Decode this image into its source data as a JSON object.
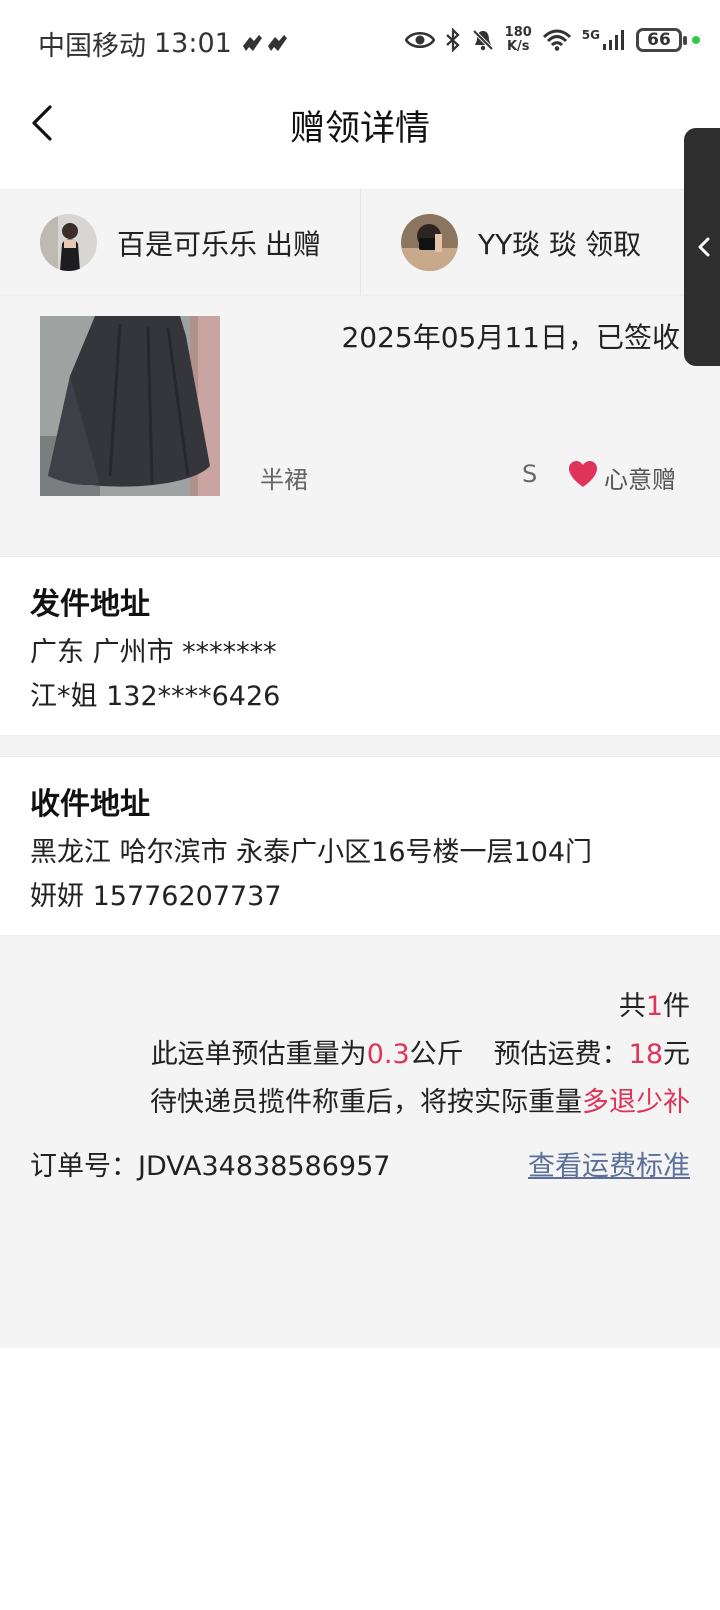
{
  "status_bar": {
    "carrier": "中国移动",
    "time": "13:01",
    "speed_top": "180",
    "speed_unit": "K/s",
    "network": "5G",
    "battery": "66"
  },
  "header": {
    "title": "赠领详情"
  },
  "parties": {
    "giver": {
      "name": "百是可乐乐",
      "action": "出赠"
    },
    "receiver": {
      "name": "YY琰 琰",
      "action": "领取"
    }
  },
  "item": {
    "date_status": "2025年05月11日，已签收",
    "name": "半裙",
    "size": "S",
    "gift_type": "心意赠"
  },
  "send_address": {
    "title": "发件地址",
    "region": "广东 广州市 *******",
    "contact": "江*姐 132****6426"
  },
  "receive_address": {
    "title": "收件地址",
    "region": "黑龙江 哈尔滨市 永泰广小区16号楼一层104门",
    "contact": "妍妍 15776207737"
  },
  "freight": {
    "count_prefix": "共",
    "count": "1",
    "count_suffix": "件",
    "weight_prefix": "此运单预估重量为",
    "weight": "0.3",
    "weight_unit": "公斤",
    "fee_prefix": "预估运费：",
    "fee": "18",
    "fee_unit": "元",
    "note_prefix": "待快递员揽件称重后，将按实际重量",
    "note_highlight": "多退少补",
    "order_no": "订单号：JDVA34838586957",
    "standard_link": "查看运费标准"
  },
  "colors": {
    "accent_red": "#e0335a",
    "link_blue": "#5b6f99",
    "section_bg": "#f4f4f4"
  }
}
